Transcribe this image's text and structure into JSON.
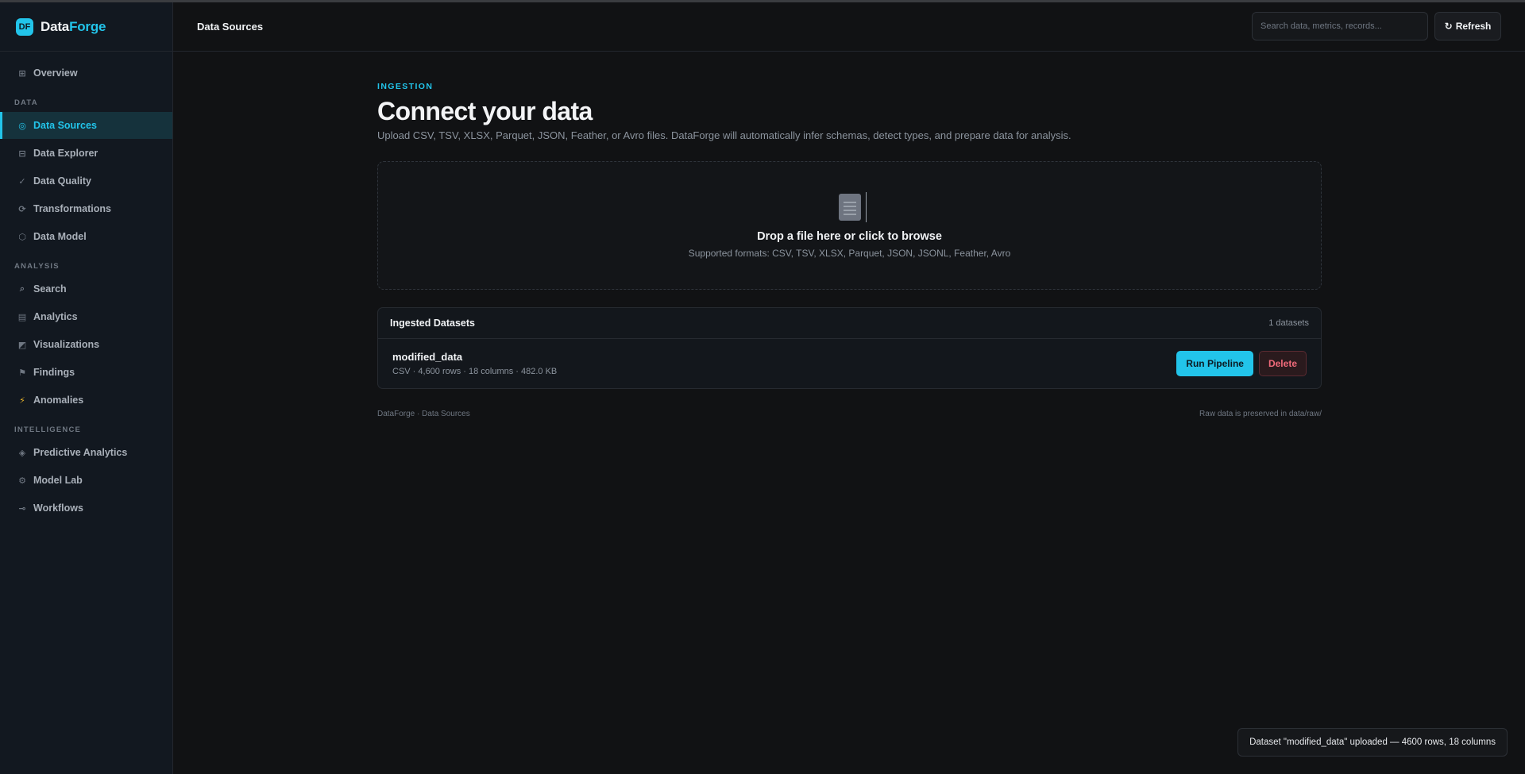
{
  "brand": {
    "logo_text": "DF",
    "name_part1": "Data",
    "name_part2": "Forge"
  },
  "sidebar": {
    "overview": {
      "label": "Overview",
      "icon": "⊞"
    },
    "sections": {
      "data": "DATA",
      "analysis": "ANALYSIS",
      "intelligence": "INTELLIGENCE"
    },
    "data_items": [
      {
        "label": "Data Sources",
        "icon": "◎"
      },
      {
        "label": "Data Explorer",
        "icon": "⊟"
      },
      {
        "label": "Data Quality",
        "icon": "✓"
      },
      {
        "label": "Transformations",
        "icon": "⟳"
      },
      {
        "label": "Data Model",
        "icon": "⬡"
      }
    ],
    "analysis_items": [
      {
        "label": "Search",
        "icon": "⌕"
      },
      {
        "label": "Analytics",
        "icon": "▤"
      },
      {
        "label": "Visualizations",
        "icon": "◩"
      },
      {
        "label": "Findings",
        "icon": "⚑"
      },
      {
        "label": "Anomalies",
        "icon": "⚡"
      }
    ],
    "intelligence_items": [
      {
        "label": "Predictive Analytics",
        "icon": "◈"
      },
      {
        "label": "Model Lab",
        "icon": "⚙"
      },
      {
        "label": "Workflows",
        "icon": "⊸"
      }
    ],
    "active": "Data Sources"
  },
  "topbar": {
    "title": "Data Sources",
    "search_placeholder": "Search data, metrics, records...",
    "refresh_label": "Refresh",
    "refresh_icon": "↻"
  },
  "main": {
    "eyebrow": "INGESTION",
    "title": "Connect your data",
    "subtitle": "Upload CSV, TSV, XLSX, Parquet, JSON, Feather, or Avro files. DataForge will automatically infer schemas, detect types, and prepare data for analysis.",
    "dropzone": {
      "title": "Drop a file here or click to browse",
      "formats": "Supported formats: CSV, TSV, XLSX, Parquet, JSON, JSONL, Feather, Avro"
    },
    "datasets": {
      "title": "Ingested Datasets",
      "count": "1 datasets",
      "rows": [
        {
          "name": "modified_data",
          "meta": "CSV · 4,600 rows · 18 columns · 482.0 KB",
          "run_label": "Run Pipeline",
          "delete_label": "Delete"
        }
      ]
    },
    "footer_left": "DataForge · Data Sources",
    "footer_right": "Raw data is preserved in data/raw/"
  },
  "toast": {
    "message": "Dataset \"modified_data\" uploaded — 4600 rows, 18 columns"
  },
  "colors": {
    "accent": "#22c4ea",
    "danger": "#f06a7a",
    "background": "#111214"
  }
}
